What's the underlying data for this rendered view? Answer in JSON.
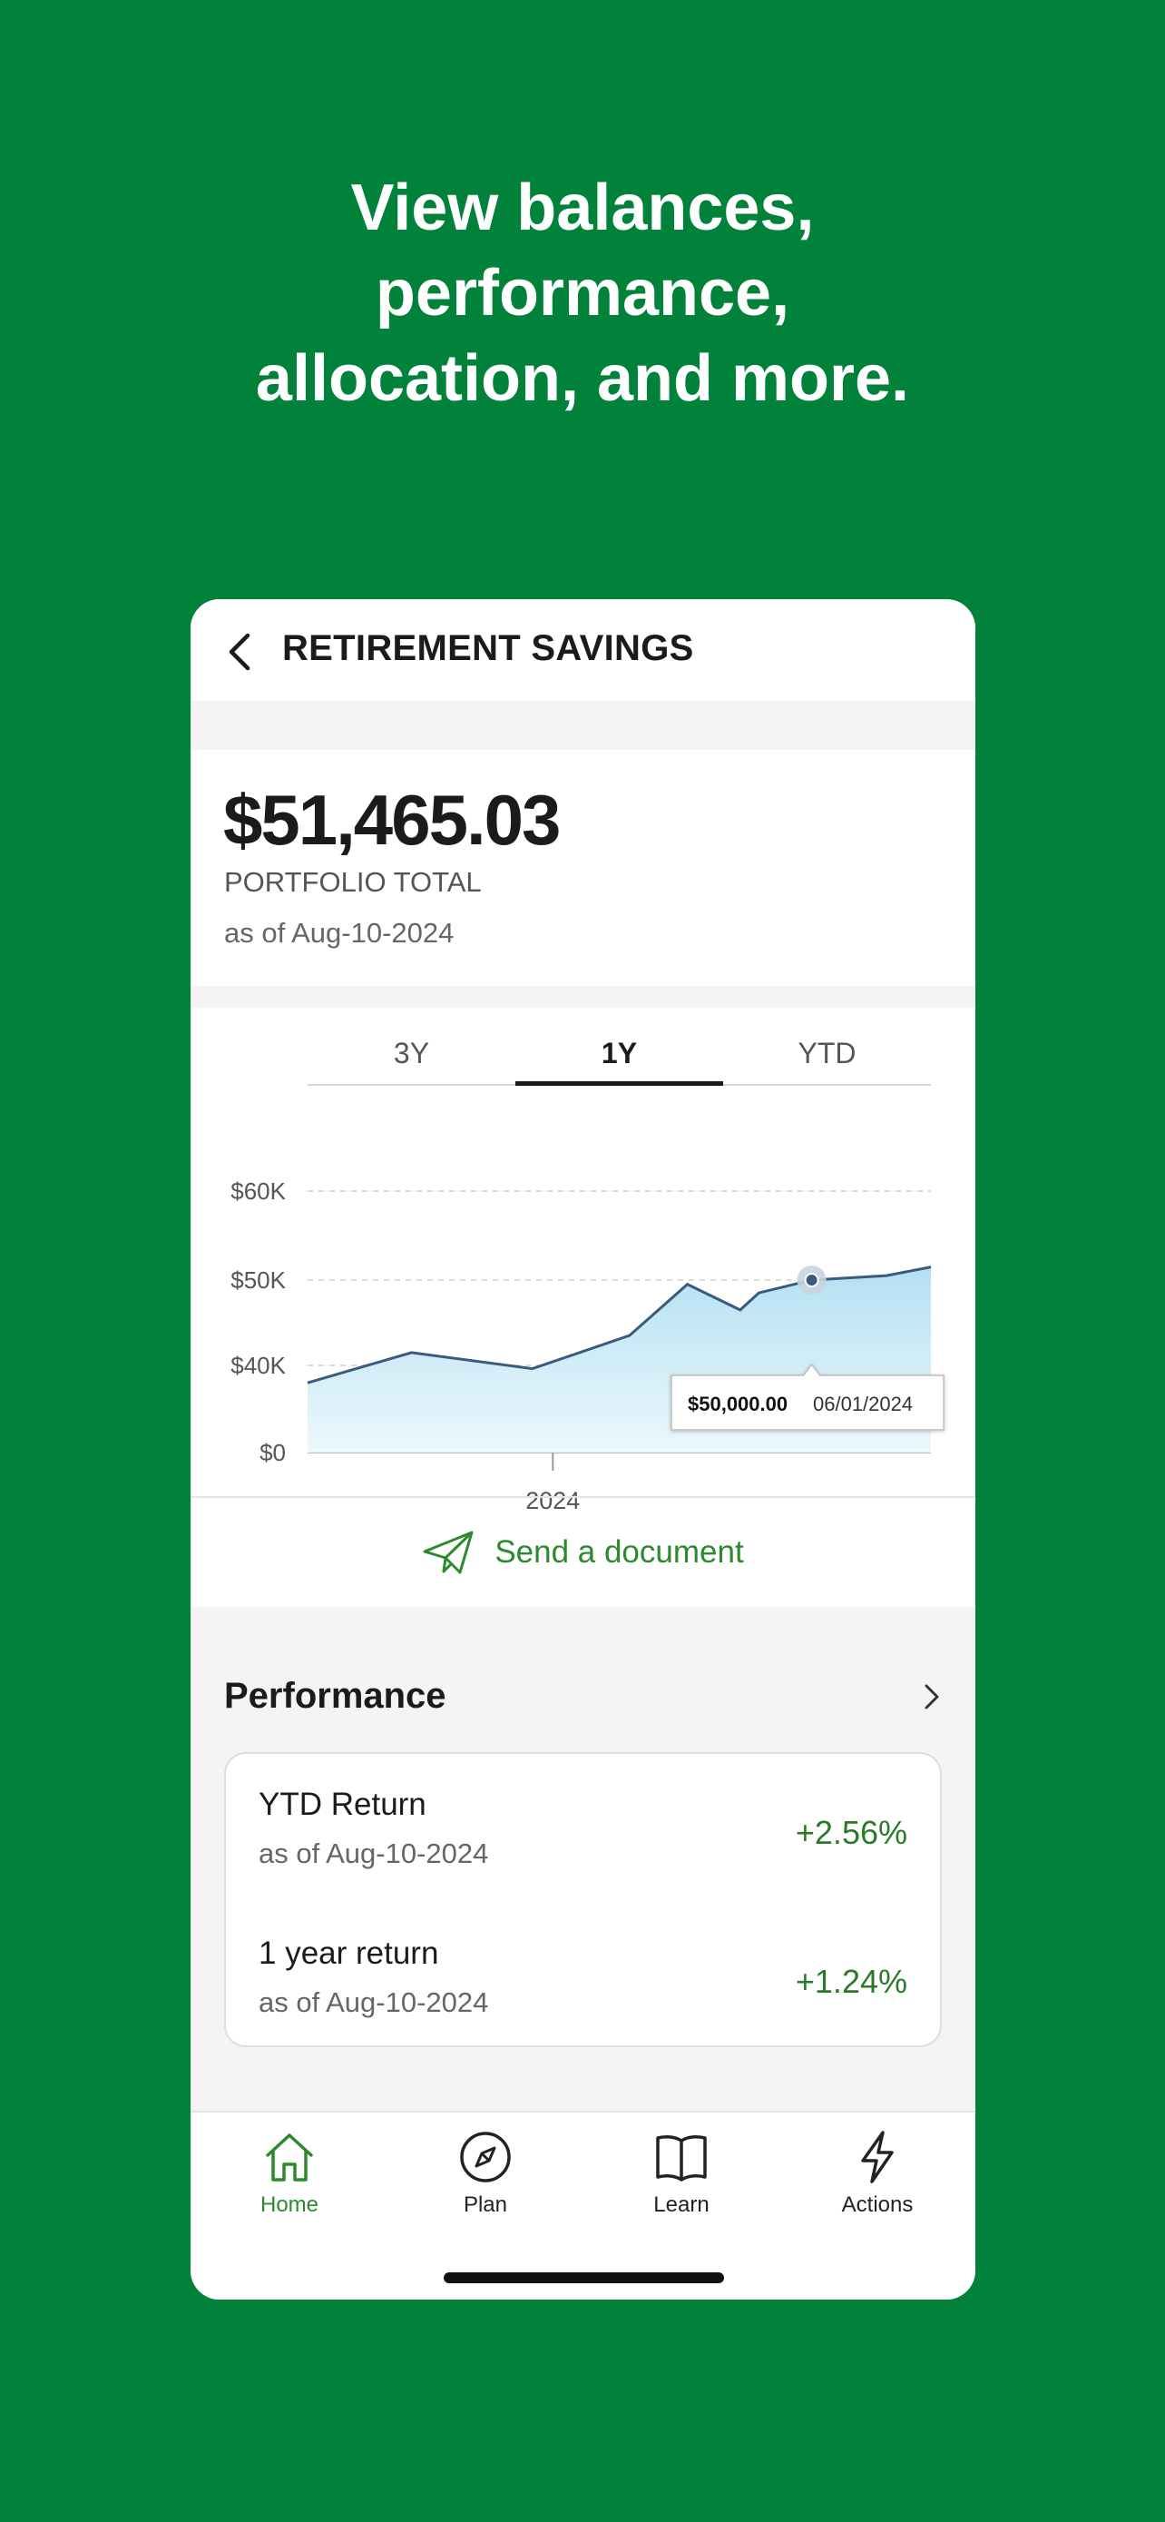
{
  "headline": {
    "line1": "View balances,",
    "line2": "performance,",
    "line3": "allocation, and more."
  },
  "topbar": {
    "title": "RETIREMENT SAVINGS",
    "back_icon": "chevron-left-icon"
  },
  "portfolio": {
    "amount": "$51,465.03",
    "label": "PORTFOLIO TOTAL",
    "as_of": "as of Aug-10-2024"
  },
  "range_tabs": [
    {
      "label": "3Y",
      "active": false
    },
    {
      "label": "1Y",
      "active": true
    },
    {
      "label": "YTD",
      "active": false
    }
  ],
  "chart_data": {
    "type": "area",
    "y_ticks": [
      "$60K",
      "$50K",
      "$40K",
      "$0"
    ],
    "x_ticks": [
      "2024"
    ],
    "points": [
      {
        "x": "2023-08-10",
        "y": 32000
      },
      {
        "x": "2023-10-10",
        "y": 41500
      },
      {
        "x": "2023-12-20",
        "y": 38500
      },
      {
        "x": "2024-02-15",
        "y": 43500
      },
      {
        "x": "2024-03-20",
        "y": 49500
      },
      {
        "x": "2024-04-20",
        "y": 46500
      },
      {
        "x": "2024-05-01",
        "y": 48500
      },
      {
        "x": "2024-06-01",
        "y": 50000
      },
      {
        "x": "2024-07-15",
        "y": 50500
      },
      {
        "x": "2024-08-10",
        "y": 51465
      }
    ],
    "tooltip": {
      "value": "$50,000.00",
      "date": "06/01/2024"
    },
    "line_color": "#3a5a80",
    "fill_color": "#bde4f4"
  },
  "send_document": {
    "label": "Send a document",
    "icon": "paper-plane-icon"
  },
  "performance": {
    "title": "Performance",
    "rows": [
      {
        "title": "YTD Return",
        "as_of": "as of Aug-10-2024",
        "value": "+2.56%"
      },
      {
        "title": "1 year return",
        "as_of": "as of Aug-10-2024",
        "value": "+1.24%"
      }
    ]
  },
  "nav": [
    {
      "label": "Home",
      "icon": "home-icon",
      "active": true
    },
    {
      "label": "Plan",
      "icon": "compass-icon",
      "active": false
    },
    {
      "label": "Learn",
      "icon": "book-icon",
      "active": false
    },
    {
      "label": "Actions",
      "icon": "lightning-icon",
      "active": false
    }
  ],
  "colors": {
    "brand_green": "#00823a",
    "positive": "#2a7a2a",
    "accent_green": "#2c8a2c"
  }
}
